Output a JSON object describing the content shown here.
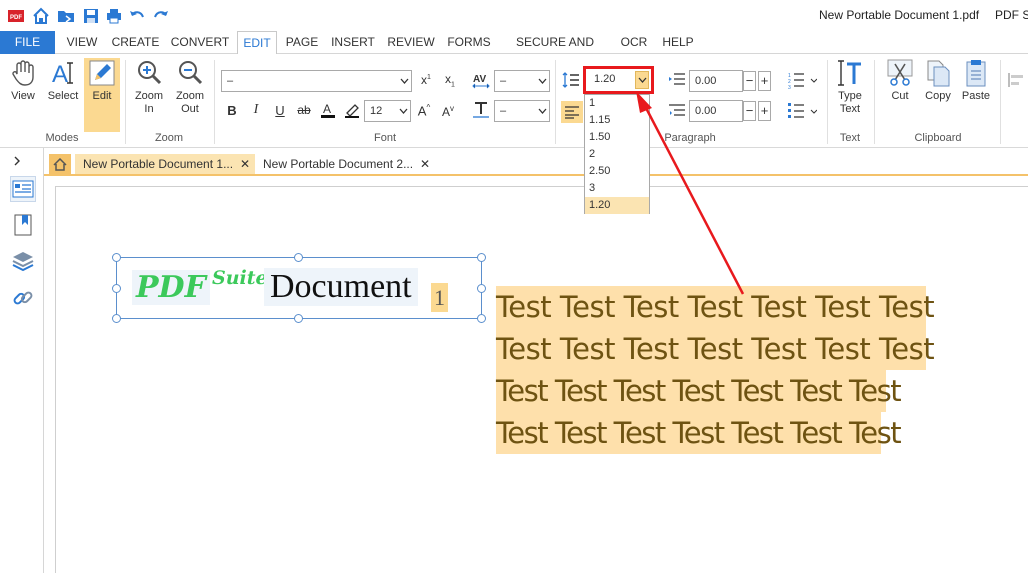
{
  "titlebar": {
    "document_title": "New Portable Document 1.pdf",
    "app_title": "PDF Su",
    "quick_access": [
      "app-logo",
      "home",
      "folder-open",
      "save",
      "print",
      "undo",
      "redo"
    ]
  },
  "menu": {
    "file": "FILE",
    "items": [
      "VIEW",
      "CREATE",
      "CONVERT",
      "EDIT",
      "PAGE",
      "INSERT",
      "REVIEW",
      "FORMS",
      "SECURE AND SIGN",
      "OCR",
      "HELP"
    ],
    "active": "EDIT"
  },
  "ribbon": {
    "modes": {
      "label": "Modes",
      "view": "View",
      "select": "Select",
      "edit": "Edit"
    },
    "zoom": {
      "label": "Zoom",
      "zoom_in_1": "Zoom",
      "zoom_in_2": "In",
      "zoom_out_1": "Zoom",
      "zoom_out_2": "Out"
    },
    "font": {
      "label": "Font",
      "font_name": "–",
      "font_size": "12",
      "char_spacing": "–",
      "line_height": "–"
    },
    "paragraph": {
      "label": "Paragraph",
      "line_spacing": "1.20",
      "indent_before": "0.00",
      "indent_after": "0.00",
      "line_spacing_options": [
        "1",
        "1.15",
        "1.50",
        "2",
        "2.50",
        "3",
        "1.20"
      ],
      "selected_option": "1.20"
    },
    "text": {
      "label": "Text",
      "type_text_1": "Type",
      "type_text_2": "Text"
    },
    "clipboard": {
      "label": "Clipboard",
      "cut": "Cut",
      "copy": "Copy",
      "paste": "Paste"
    }
  },
  "tabs": [
    {
      "label": "New Portable Document 1...",
      "active": true
    },
    {
      "label": "New Portable Document 2...",
      "active": false
    }
  ],
  "document": {
    "logo_pdf": "PDF",
    "logo_suite": "Suite",
    "logo_document": "Document",
    "logo_number": "1",
    "test_lines": [
      "Test Test Test Test Test Test Test",
      "Test Test Test Test Test Test Test",
      "Test Test Test Test Test Test Test",
      "Test Test Test Test Test Test Test"
    ]
  },
  "colors": {
    "accent_blue": "#2b79d3",
    "highlight_orange": "#fbd991",
    "annotation_red": "#e8191d",
    "logo_green": "#3cc95b",
    "text_highlight": "#fee0ab"
  }
}
